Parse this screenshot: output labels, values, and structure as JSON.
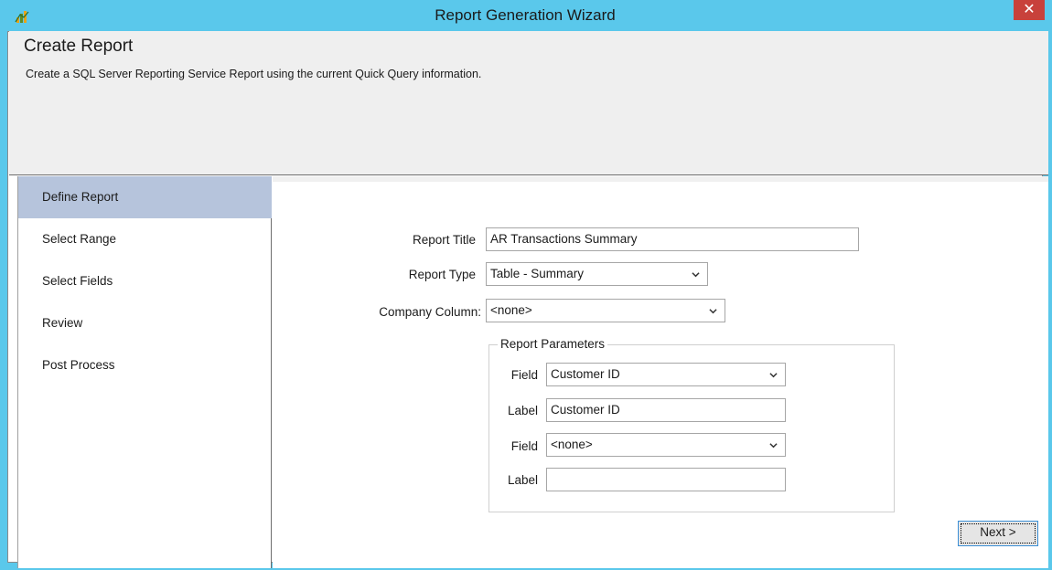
{
  "window": {
    "title": "Report Generation Wizard",
    "close_glyph": "✕",
    "app_icon": "chart-bars-icon",
    "accent_color": "#5ac8eb",
    "close_color": "#c8413b"
  },
  "header": {
    "title": "Create Report",
    "description": "Create a SQL Server Reporting Service Report using the current Quick Query information."
  },
  "nav": {
    "items": [
      {
        "label": "Define Report",
        "selected": true
      },
      {
        "label": "Select Range",
        "selected": false
      },
      {
        "label": "Select Fields",
        "selected": false
      },
      {
        "label": "Review",
        "selected": false
      },
      {
        "label": "Post Process",
        "selected": false
      }
    ],
    "selected_color": "#b6c4dc"
  },
  "form": {
    "report_title_label": "Report Title",
    "report_title_value": "AR Transactions Summary",
    "report_type_label": "Report Type",
    "report_type_value": "Table - Summary",
    "company_column_label": "Company Column:",
    "company_column_value": "<none>"
  },
  "parameters": {
    "group_title": "Report Parameters",
    "field1_label": "Field",
    "field1_value": "Customer ID",
    "label1_label": "Label",
    "label1_value": "Customer ID",
    "field2_label": "Field",
    "field2_value": "<none>",
    "label2_label": "Label",
    "label2_value": ""
  },
  "buttons": {
    "next_label": "Next >"
  }
}
